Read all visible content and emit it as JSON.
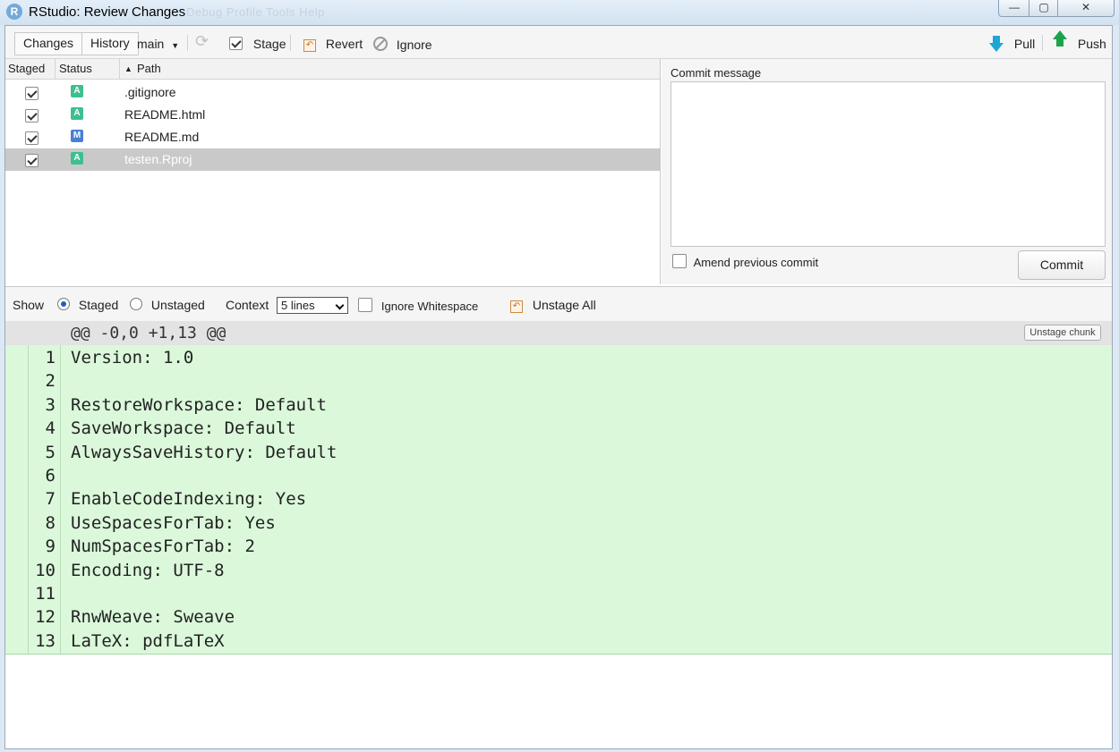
{
  "window": {
    "title": "RStudio: Review Changes",
    "app_icon": "R",
    "ghost_menu": "Debug   Profile   Tools   Help",
    "controls": {
      "minimize": "—",
      "maximize": "▢",
      "close": "✕"
    }
  },
  "toolbar": {
    "changes_label": "Changes",
    "history_label": "History",
    "branch": "main",
    "stage_label": "Stage",
    "revert_label": "Revert",
    "ignore_label": "Ignore",
    "pull_label": "Pull",
    "push_label": "Push"
  },
  "file_list": {
    "columns": {
      "staged": "Staged",
      "status": "Status",
      "path": "Path"
    },
    "sort_indicator": "▲",
    "files": [
      {
        "staged": true,
        "status": "A",
        "status_color": "#3cc08e",
        "path": ".gitignore",
        "selected": false
      },
      {
        "staged": true,
        "status": "A",
        "status_color": "#3cc08e",
        "path": "README.html",
        "selected": false
      },
      {
        "staged": true,
        "status": "M",
        "status_color": "#4a7fd4",
        "path": "README.md",
        "selected": false
      },
      {
        "staged": true,
        "status": "A",
        "status_color": "#3cc08e",
        "path": "testen.Rproj",
        "selected": true
      }
    ]
  },
  "commit": {
    "label": "Commit message",
    "message": "",
    "amend_label": "Amend previous commit",
    "amend_checked": false,
    "button_label": "Commit"
  },
  "diff_controls": {
    "show_label": "Show",
    "staged_label": "Staged",
    "unstaged_label": "Unstaged",
    "selected_view": "Staged",
    "context_label": "Context",
    "context_value": "5 lines",
    "ignore_whitespace_label": "Ignore Whitespace",
    "ignore_whitespace_checked": false,
    "unstage_all_label": "Unstage All"
  },
  "diff": {
    "hunk_header": "@@ -0,0 +1,13 @@",
    "unstage_chunk_label": "Unstage chunk",
    "lines": [
      {
        "num": "1",
        "text": "Version: 1.0"
      },
      {
        "num": "2",
        "text": ""
      },
      {
        "num": "3",
        "text": "RestoreWorkspace: Default"
      },
      {
        "num": "4",
        "text": "SaveWorkspace: Default"
      },
      {
        "num": "5",
        "text": "AlwaysSaveHistory: Default"
      },
      {
        "num": "6",
        "text": ""
      },
      {
        "num": "7",
        "text": "EnableCodeIndexing: Yes"
      },
      {
        "num": "8",
        "text": "UseSpacesForTab: Yes"
      },
      {
        "num": "9",
        "text": "NumSpacesForTab: 2"
      },
      {
        "num": "10",
        "text": "Encoding: UTF-8"
      },
      {
        "num": "11",
        "text": ""
      },
      {
        "num": "12",
        "text": "RnwWeave: Sweave"
      },
      {
        "num": "13",
        "text": "LaTeX: pdfLaTeX"
      }
    ]
  }
}
